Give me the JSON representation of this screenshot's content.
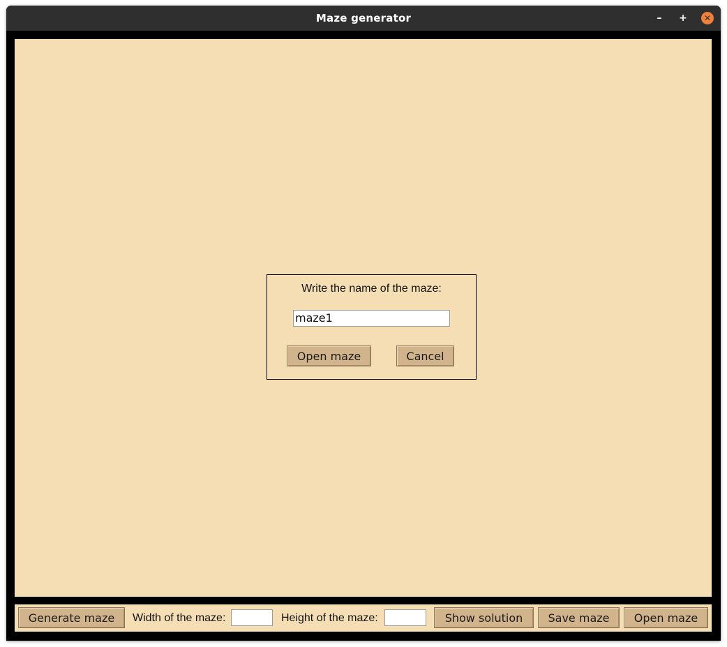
{
  "window": {
    "title": "Maze generator",
    "minimize_glyph": "–",
    "maximize_glyph": "+",
    "close_glyph": "✕"
  },
  "dialog": {
    "prompt": "Write the name of the maze:",
    "name_value": "maze1",
    "open_label": "Open maze",
    "cancel_label": "Cancel"
  },
  "toolbar": {
    "generate_label": "Generate maze",
    "width_label": "Width of the maze:",
    "width_value": "",
    "height_label": "Height of the maze:",
    "height_value": "",
    "show_solution_label": "Show solution",
    "save_label": "Save maze",
    "open_label": "Open maze"
  },
  "colors": {
    "canvas_bg": "#f5deb3",
    "button_bg": "#d2b48c",
    "titlebar_bg": "#2f2f2f",
    "close_button": "#f0803c",
    "frame_bg": "#000000"
  }
}
